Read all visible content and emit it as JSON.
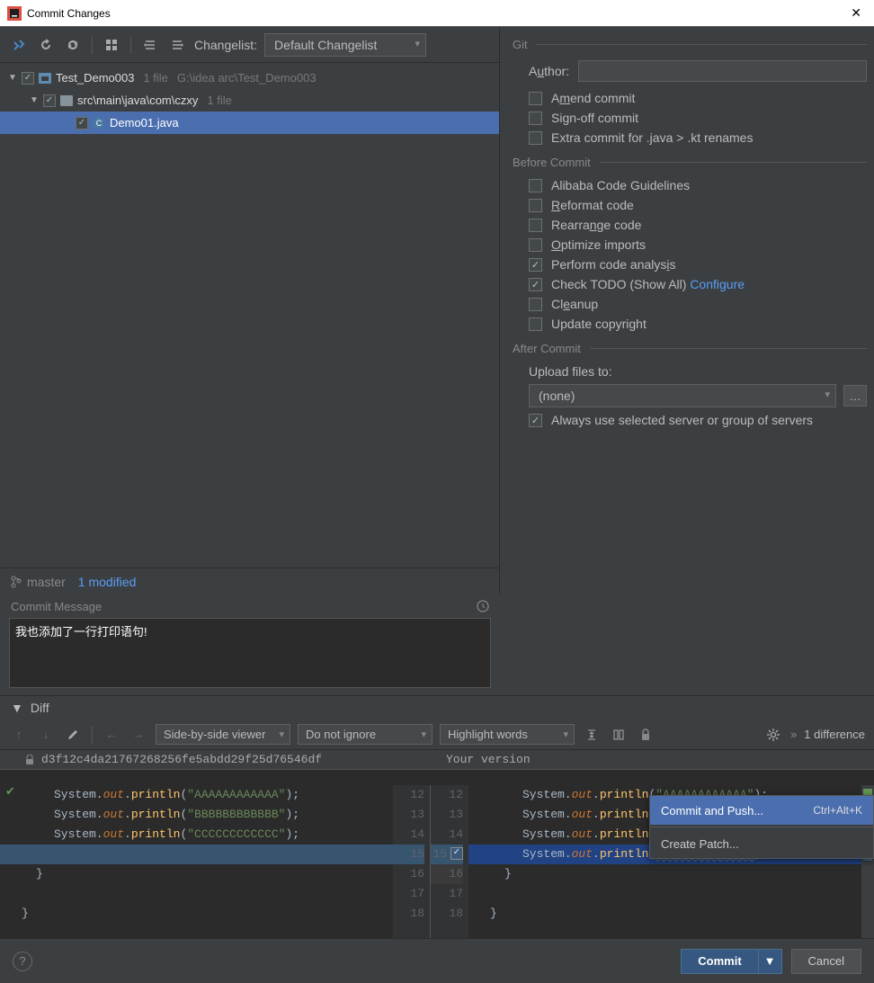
{
  "window": {
    "title": "Commit Changes"
  },
  "toolbar": {
    "changelist_label": "Changelist:",
    "changelist_value": "Default Changelist"
  },
  "tree": {
    "root": {
      "name": "Test_Demo003",
      "info1": "1 file",
      "info2": "G:\\idea arc\\Test_Demo003"
    },
    "sub": {
      "name": "src\\main\\java\\com\\czxy",
      "info1": "1 file"
    },
    "file": {
      "name": "Demo01.java"
    }
  },
  "branchbar": {
    "branch": "master",
    "modified": "1 modified"
  },
  "commit_msg": {
    "header": "Commit Message",
    "text": "我也添加了一行打印语句!"
  },
  "git": {
    "section": "Git",
    "author_label": "Author:",
    "amend": "Amend commit",
    "signoff": "Sign-off commit",
    "extra": "Extra commit for .java > .kt renames"
  },
  "before": {
    "section": "Before Commit",
    "alibaba": "Alibaba Code Guidelines",
    "reformat": "Reformat code",
    "rearrange": "Rearrange code",
    "optimize": "Optimize imports",
    "analysis": "Perform code analysis",
    "todo": "Check TODO (Show All)",
    "configure": "Configure",
    "cleanup": "Cleanup",
    "copyright": "Update copyright"
  },
  "after": {
    "section": "After Commit",
    "upload_label": "Upload files to:",
    "upload_value": "(none)",
    "always_use": "Always use selected server or group of servers"
  },
  "diff": {
    "header": "Diff",
    "viewer": "Side-by-side viewer",
    "ignore": "Do not ignore",
    "highlight": "Highlight words",
    "count": "1 difference",
    "left_rev": "d3f12c4da21767268256fe5abdd29f25d76546df",
    "right_rev": "Your version",
    "left_lines": [
      "12",
      "13",
      "14",
      "15",
      "16",
      "17",
      "18"
    ],
    "right_lines": [
      "12",
      "13",
      "14",
      "15",
      "16",
      "17",
      "18"
    ],
    "strA": "\"AAAAAAAAAAAA\"",
    "strB": "\"BBBBBBBBBBBB\"",
    "strC": "\"CCCCCCCCCCCC\"",
    "strE": "\"EEEEEEEEEEEE\""
  },
  "menu": {
    "commit_push": "Commit and Push...",
    "commit_push_short": "Ctrl+Alt+K",
    "create_patch": "Create Patch..."
  },
  "footer": {
    "commit": "Commit",
    "cancel": "Cancel"
  }
}
